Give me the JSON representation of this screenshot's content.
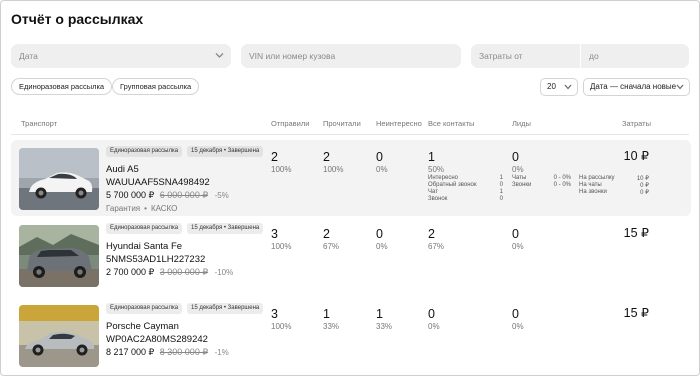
{
  "page": {
    "title": "Отчёт о рассылках"
  },
  "filters": {
    "date_placeholder": "Дата",
    "vin_placeholder": "VIN или номер кузова",
    "cost_from_placeholder": "Затраты от",
    "cost_to_placeholder": "до"
  },
  "mailing_types": [
    "Единоразовая рассылка",
    "Групповая рассылка"
  ],
  "pagination": {
    "per_page": "20"
  },
  "sort": {
    "selected": "Дата — сначала новые"
  },
  "table": {
    "headers": {
      "transport": "Транспорт",
      "sent": "Отправили",
      "read": "Прочитали",
      "not_interested": "Неинтересно",
      "all_contacts": "Все контакты",
      "leads": "Лиды",
      "cost": "Затраты"
    },
    "rows": [
      {
        "mailing_tag": "Единоразовая рассылка",
        "date_tag": "15 декабря • Завершена",
        "name": "Audi A5",
        "vin": "WAUUAAF5SNA498492",
        "price": "5 700 000 ₽",
        "old_price": "6 000 000 ₽",
        "discount": "-5%",
        "extras": [
          "Гарантия",
          "КАСКО"
        ],
        "sent": "2",
        "sent_pct": "100%",
        "read": "2",
        "read_pct": "100%",
        "not_interested": "0",
        "not_interested_pct": "0%",
        "contacts": "1",
        "contacts_pct": "50%",
        "contacts_breakdown": [
          {
            "label": "Интересно",
            "value": "1"
          },
          {
            "label": "Обратный звонок",
            "value": "0"
          },
          {
            "label": "Чат",
            "value": "1"
          },
          {
            "label": "Звонок",
            "value": "0"
          }
        ],
        "leads": "0",
        "leads_pct": "0%",
        "leads_breakdown": [
          {
            "label": "Чаты",
            "value": "0 - 0%"
          },
          {
            "label": "Звонки",
            "value": "0 - 0%"
          }
        ],
        "cost": "10 ₽",
        "cost_breakdown": [
          {
            "label": "На рассылку",
            "value": "10 ₽"
          },
          {
            "label": "На чаты",
            "value": "0 ₽"
          },
          {
            "label": "На звонки",
            "value": "0 ₽"
          }
        ]
      },
      {
        "mailing_tag": "Единоразовая рассылка",
        "date_tag": "15 декабря • Завершена",
        "name": "Hyundai Santa Fe",
        "vin": "5NMS53AD1LH227232",
        "price": "2 700 000 ₽",
        "old_price": "3 000 000 ₽",
        "discount": "-10%",
        "sent": "3",
        "sent_pct": "100%",
        "read": "2",
        "read_pct": "67%",
        "not_interested": "0",
        "not_interested_pct": "0%",
        "contacts": "2",
        "contacts_pct": "67%",
        "leads": "0",
        "leads_pct": "0%",
        "cost": "15 ₽"
      },
      {
        "mailing_tag": "Единоразовая рассылка",
        "date_tag": "15 декабря • Завершена",
        "name": "Porsche Cayman",
        "vin": "WP0AC2A80MS289242",
        "price": "8 217 000 ₽",
        "old_price": "8 300 000 ₽",
        "discount": "-1%",
        "sent": "3",
        "sent_pct": "100%",
        "read": "1",
        "read_pct": "33%",
        "not_interested": "1",
        "not_interested_pct": "33%",
        "contacts": "0",
        "contacts_pct": "0%",
        "leads": "0",
        "leads_pct": "0%",
        "cost": "15 ₽"
      }
    ]
  },
  "icons": {
    "dropdown": "chevron-down-icon"
  },
  "colors": {
    "highlight_row": "#f3f3f3",
    "field_bg": "#efefef",
    "muted_text": "#777777"
  }
}
